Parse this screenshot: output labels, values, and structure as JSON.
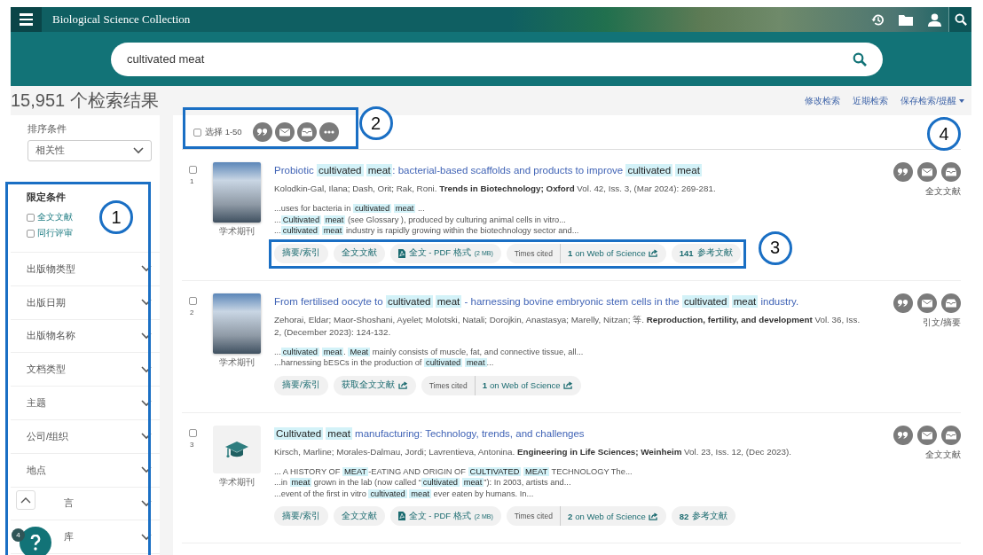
{
  "header": {
    "title": "Biological Science Collection"
  },
  "search": {
    "value": "cultivated meat"
  },
  "results_bar": {
    "count": "15,951 个检索结果",
    "links": [
      "修改检索",
      "近期检索"
    ],
    "save_menu": "保存检索/提醒"
  },
  "sidebar": {
    "sort": {
      "label": "排序条件",
      "value": "相关性"
    },
    "limits": {
      "title": "限定条件",
      "options": [
        {
          "label": "全文文献",
          "checked": false
        },
        {
          "label": "同行评审",
          "checked": false
        }
      ]
    },
    "facets": [
      {
        "label": "出版物类型",
        "covered": false
      },
      {
        "label": "出版日期",
        "covered": false
      },
      {
        "label": "出版物名称",
        "covered": false
      },
      {
        "label": "文档类型",
        "covered": false
      },
      {
        "label": "主题",
        "covered": false
      },
      {
        "label": "公司/组织",
        "covered": false
      },
      {
        "label": "地点",
        "covered": false
      },
      {
        "label": "言",
        "covered": true
      },
      {
        "label": "库",
        "covered": true
      }
    ]
  },
  "toolbar": {
    "select_label": "选择 1-50",
    "checked": false
  },
  "results": [
    {
      "number": "1",
      "checked": false,
      "thumbnail": {
        "kind": "cover"
      },
      "type_label": "学术期刊",
      "access_label": "全文文献",
      "title": "Probiotic **cultivated** **meat**: bacterial-based scaffolds and products to improve **cultivated** **meat**",
      "citation": "Kolodkin-Gal, Ilana; Dash, Orit; Rak, Roni.  **Trends in Biotechnology; Oxford** Vol. 42, Iss. 3,  (Mar 2024): 269-281.",
      "snippets": [
        "...uses for bacteria in **cultivated** **meat** ...",
        "...**Cultivated** **meat** (see Glossary ), produced by culturing animal cells in vitro...",
        "...**cultivated** **meat** industry is rapidly growing within the biotechnology sector and..."
      ],
      "actions": [
        {
          "kind": "link",
          "label": "摘要/索引"
        },
        {
          "kind": "link",
          "label": "全文文献"
        },
        {
          "kind": "pdf",
          "label": "全文 - PDF 格式",
          "size": "(2 MB)"
        },
        {
          "kind": "cited",
          "label": "Times cited",
          "value": "**1** on Web of Science"
        },
        {
          "kind": "link",
          "label": "**141** 参考文献"
        }
      ]
    },
    {
      "number": "2",
      "checked": false,
      "thumbnail": {
        "kind": "cover"
      },
      "type_label": "学术期刊",
      "access_label": "引文/摘要",
      "title": "From fertilised oocyte to **cultivated** **meat** - harnessing bovine embryonic stem cells in the **cultivated** **meat** industry.",
      "citation": "Zehorai, Eldar; Maor-Shoshani, Ayelet; Molotski, Natali; Dorojkin, Anastasya; Marelly, Nitzan; 等.  **Reproduction, fertility, and development** Vol. 36, Iss. 2, (December 2023): 124-132.",
      "snippets": [
        "...**cultivated** **meat**. **Meat** mainly consists of muscle, fat, and connective tissue, all...",
        "...harnessing bESCs in the production of **cultivated** **meat**..."
      ],
      "actions": [
        {
          "kind": "link",
          "label": "摘要/索引"
        },
        {
          "kind": "external",
          "label": "获取全文文献"
        },
        {
          "kind": "cited",
          "label": "Times cited",
          "value": "**1** on Web of Science"
        }
      ]
    },
    {
      "number": "3",
      "checked": false,
      "thumbnail": {
        "kind": "placeholder"
      },
      "type_label": "学术期刊",
      "access_label": "全文文献",
      "title": "**Cultivated** **meat** manufacturing: Technology, trends, and challenges",
      "citation": "Kirsch, Marline; Morales-Dalmau, Jordi; Lavrentieva, Antonina.  **Engineering in Life Sciences; Weinheim** Vol. 23, Iss. 12,  (Dec 2023).",
      "snippets": [
        "... A HISTORY OF **MEAT**-EATING AND ORIGIN OF **CULTIVATED** **MEAT** TECHNOLOGY The...",
        "...in **meat** grown in the lab (now called “**cultivated** **meat**”): In 2003, artists and...",
        "...event of the first in vitro **cultivated** **meat** ever eaten by humans. In..."
      ],
      "actions": [
        {
          "kind": "link",
          "label": "摘要/索引"
        },
        {
          "kind": "link",
          "label": "全文文献"
        },
        {
          "kind": "pdf",
          "label": "全文 - PDF 格式",
          "size": "(2 MB)"
        },
        {
          "kind": "cited",
          "label": "Times cited",
          "value": "**2** on Web of Science"
        },
        {
          "kind": "link",
          "label": "**82** 参考文献"
        }
      ]
    }
  ],
  "help": {
    "badge": "4"
  },
  "callouts": [
    "1",
    "2",
    "3",
    "4"
  ]
}
